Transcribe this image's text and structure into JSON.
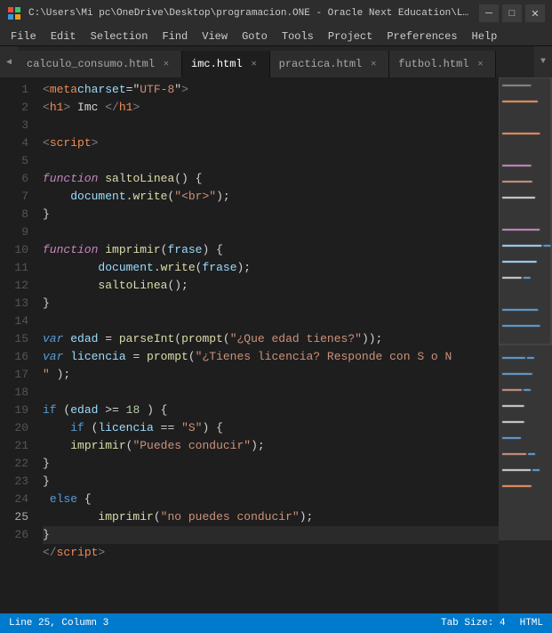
{
  "titleBar": {
    "icon": "◆",
    "title": "C:\\Users\\Mi pc\\OneDrive\\Desktop\\programacion.ONE - Oracle Next Education\\Log...",
    "minimize": "─",
    "maximize": "□",
    "close": "✕"
  },
  "menuBar": {
    "items": [
      "File",
      "Edit",
      "Selection",
      "Find",
      "View",
      "Goto",
      "Tools",
      "Project",
      "Preferences",
      "Help"
    ]
  },
  "tabs": [
    {
      "label": "calculo_consumo.html",
      "active": false,
      "closable": true
    },
    {
      "label": "imc.html",
      "active": true,
      "closable": true
    },
    {
      "label": "practica.html",
      "active": false,
      "closable": true
    },
    {
      "label": "futbol.html",
      "active": false,
      "closable": true
    }
  ],
  "statusBar": {
    "position": "Line 25, Column 3",
    "tabSize": "Tab Size: 4",
    "language": "HTML"
  }
}
